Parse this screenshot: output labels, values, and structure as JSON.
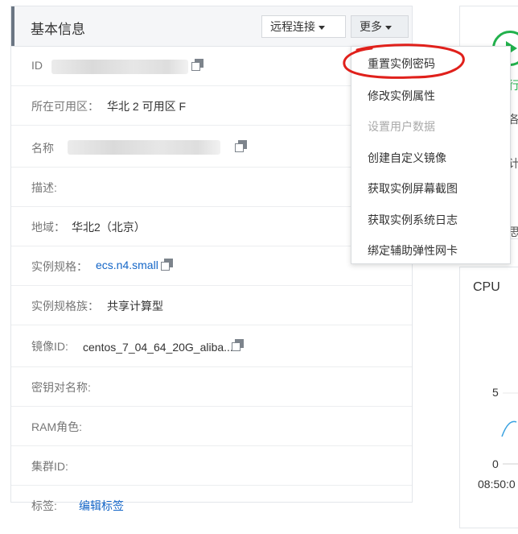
{
  "panel": {
    "title": "基本信息",
    "remote_button": "远程连接",
    "more_button": "更多"
  },
  "fields": {
    "id_label": "ID",
    "zone_label": "所在可用区：",
    "zone_value": "华北 2 可用区 F",
    "name_label": "名称",
    "desc_label": "描述:",
    "region_label": "地域：",
    "region_value": "华北2（北京）",
    "spec_label": "实例规格：",
    "spec_value": "ecs.n4.small",
    "family_label": "实例规格族：",
    "family_value": "共享计算型",
    "image_label": "镜像ID:",
    "image_value": "centos_7_04_64_20G_aliba...",
    "keypair_label": "密钥对名称:",
    "ram_label": "RAM角色:",
    "cluster_label": "集群ID:",
    "tag_label": "标签:",
    "tag_value": "编辑标签"
  },
  "dropdown": {
    "items": [
      {
        "label": "重置实例密码",
        "enabled": true
      },
      {
        "label": "修改实例属性",
        "enabled": true
      },
      {
        "label": "设置用户数据",
        "enabled": false
      },
      {
        "label": "创建自定义镜像",
        "enabled": true
      },
      {
        "label": "获取实例屏幕截图",
        "enabled": true
      },
      {
        "label": "获取实例系统日志",
        "enabled": true
      },
      {
        "label": "绑定辅助弹性网卡",
        "enabled": true
      }
    ]
  },
  "right_panel": {
    "frag1": "行",
    "frag2": "各",
    "frag3": "计",
    "frag4": "思",
    "cpu_title": "CPU",
    "y_tick_top": "5",
    "y_tick_bottom": "0",
    "x_tick": "08:50:0"
  },
  "colors": {
    "link": "#1466c7",
    "annotation": "#e0201b",
    "status_green": "#22b14c"
  },
  "icons": [
    "copy-icon",
    "caret-down-icon",
    "play-icon"
  ]
}
